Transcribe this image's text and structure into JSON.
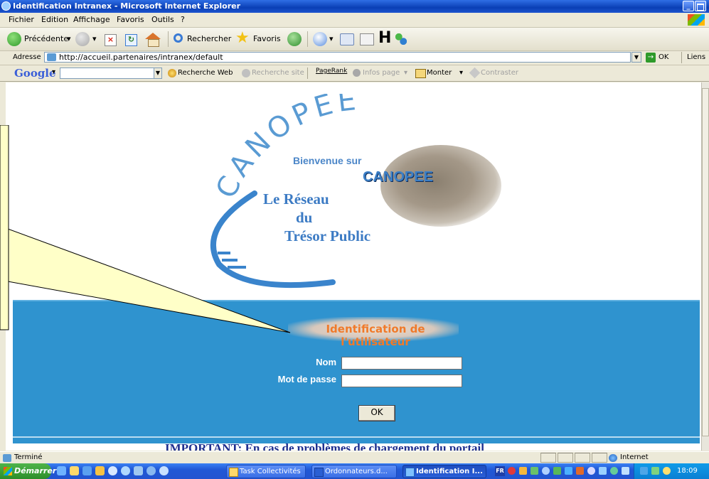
{
  "window": {
    "title": "Identification Intranex - Microsoft Internet Explorer",
    "controls": [
      "_",
      "×"
    ]
  },
  "menu": [
    "Fichier",
    "Edition",
    "Affichage",
    "Favoris",
    "Outils",
    "?"
  ],
  "toolbar": {
    "back_label": "Précédente",
    "search_label": "Rechercher",
    "favorites_label": "Favoris"
  },
  "address": {
    "label": "Adresse",
    "url": "http://accueil.partenaires/intranex/default",
    "go_label": "OK",
    "links_label": "Liens"
  },
  "googlebar": {
    "logo": "Google",
    "search_web": "Recherche Web",
    "search_site": "Recherche site",
    "pagerank": "PageRank",
    "infos_page": "Infos page",
    "monter": "Monter",
    "contraster": "Contraster"
  },
  "page": {
    "logo_arc_text": "CANOPEE",
    "welcome": "Bienvenue sur",
    "brand": "CANOPEE",
    "tagline_1": "Le Réseau",
    "tagline_2": "du",
    "tagline_3": "Trésor Public",
    "login_title": "Identification de l'utilisateur",
    "name_label": "Nom",
    "name_value": "",
    "password_label": "Mot de passe",
    "password_value": "",
    "ok_label": "OK",
    "important_text": "IMPORTANT: En cas de problèmes de chargement du portail"
  },
  "statusbar": {
    "text": "Terminé",
    "zone": "Internet"
  },
  "taskbar": {
    "start_label": "Démarrer",
    "tasks": [
      {
        "label": "Task Collectivités",
        "active": false
      },
      {
        "label": "Ordonnateurs.d...",
        "active": false
      },
      {
        "label": "Identification I...",
        "active": true
      }
    ],
    "clock": "18:09",
    "lang": "FR"
  },
  "colors": {
    "panel_blue": "#2f93cf",
    "logo_blue": "#3c7bc4",
    "title_orange": "#f07a2a",
    "important_navy": "#1e2f8f",
    "callout_yellow": "#ffffc8"
  }
}
